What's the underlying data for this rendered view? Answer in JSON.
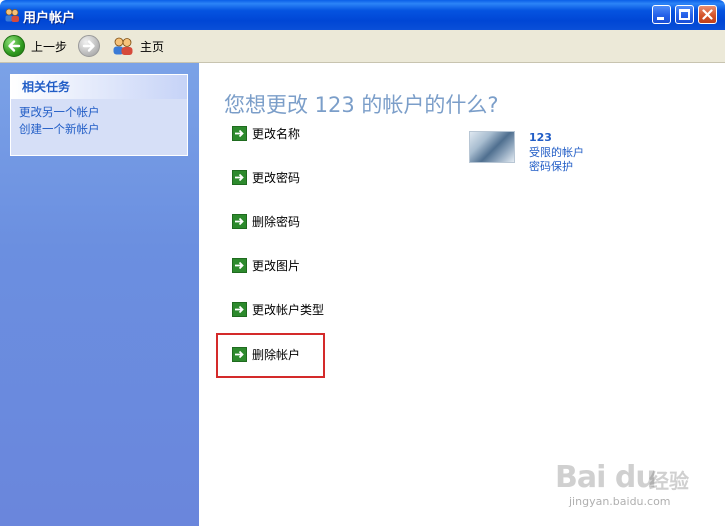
{
  "window": {
    "title": "用户帐户"
  },
  "toolbar": {
    "back_label": "上一步",
    "home_label": "主页"
  },
  "sidebar": {
    "panel_title": "相关任务",
    "links": [
      "更改另一个帐户",
      "创建一个新帐户"
    ]
  },
  "main": {
    "heading": "您想更改 123 的帐户的什么?",
    "actions": [
      "更改名称",
      "更改密码",
      "删除密码",
      "更改图片",
      "更改帐户类型",
      "删除帐户"
    ],
    "highlighted_action": "删除帐户",
    "highlight_color": "#d42a2a"
  },
  "account": {
    "name": "123",
    "type": "受限的帐户",
    "status": "密码保护"
  },
  "watermark": {
    "logo": "Bai du",
    "cn": "经验",
    "url": "jingyan.baidu.com"
  },
  "colors": {
    "link": "#215dc6",
    "heading": "#7b9ec9",
    "action_arrow": "#2d8a2d"
  }
}
